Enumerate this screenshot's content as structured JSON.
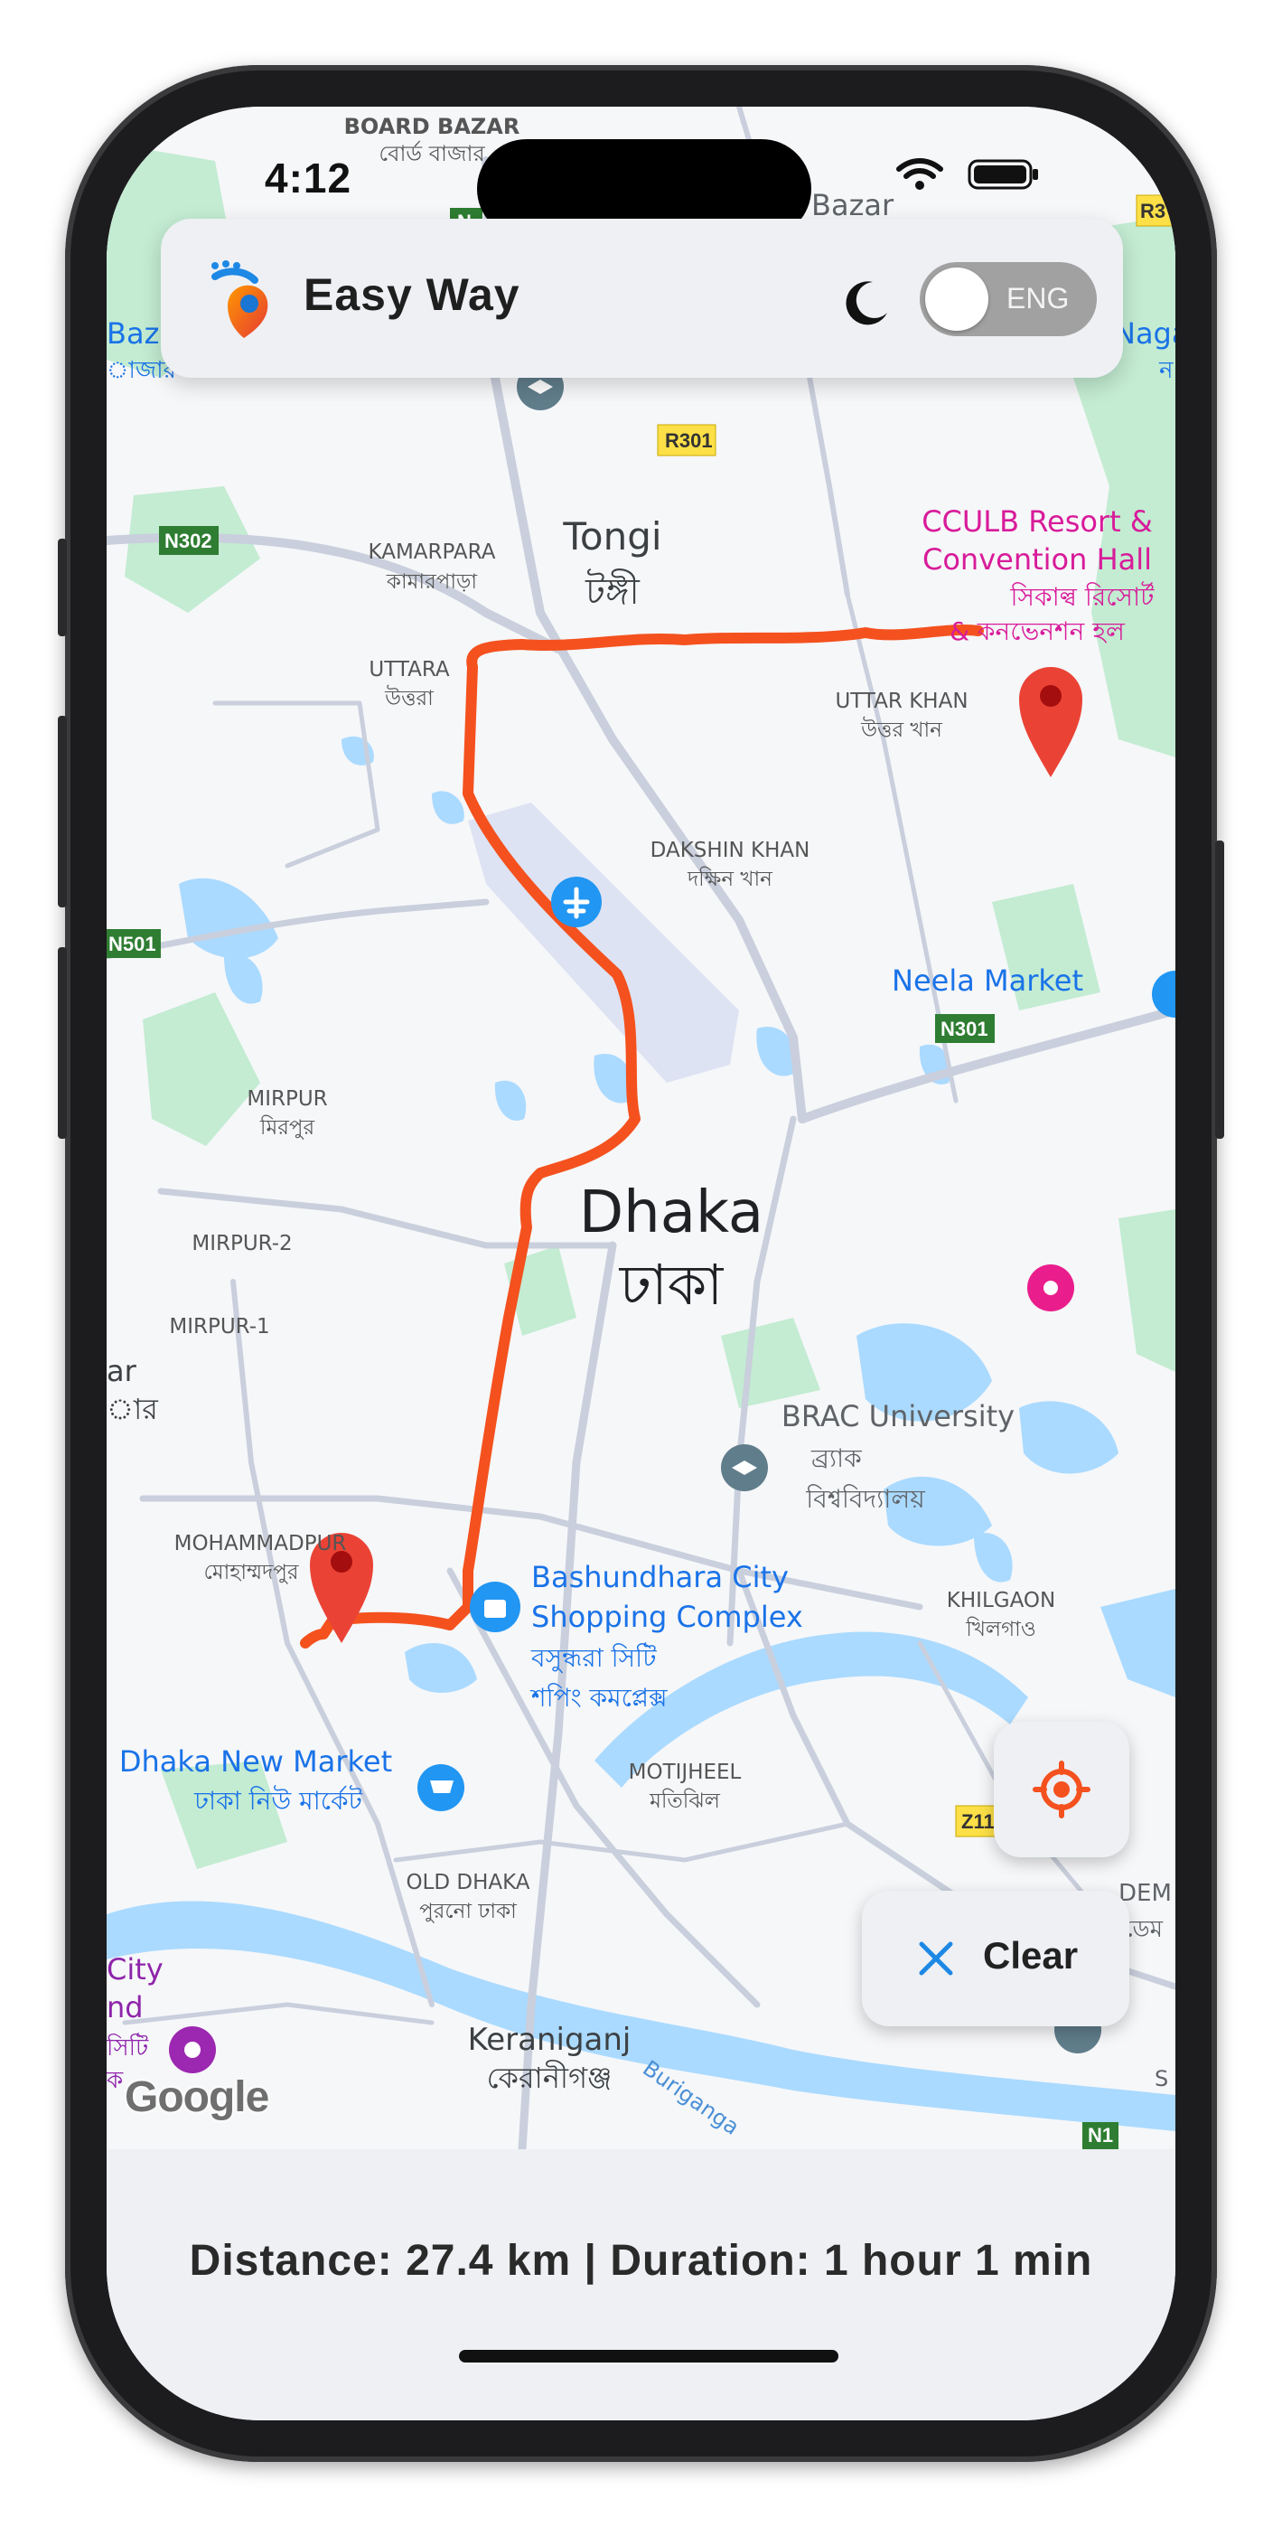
{
  "status_bar": {
    "time": "4:12"
  },
  "header": {
    "app_name": "Easy Way",
    "language_toggle_label": "ENG",
    "dark_mode_icon": "moon-icon"
  },
  "map": {
    "provider_logo": "Google",
    "place_labels": [
      {
        "id": "board-bazar",
        "en": "BOARD BAZAR",
        "bn": "বোর্ড বাজার"
      },
      {
        "id": "kamarpara",
        "en": "KAMARPARA",
        "bn": "কামারপাড়া"
      },
      {
        "id": "tongi",
        "en": "Tongi",
        "bn": "টঙ্গী"
      },
      {
        "id": "uttara",
        "en": "UTTARA",
        "bn": "উত্তরা"
      },
      {
        "id": "uttar-khan",
        "en": "UTTAR KHAN",
        "bn": "উত্তর খান"
      },
      {
        "id": "dakshin-khan",
        "en": "DAKSHIN KHAN",
        "bn": "দক্ষিন খান"
      },
      {
        "id": "mirpur",
        "en": "MIRPUR",
        "bn": "মিরপুর"
      },
      {
        "id": "mirpur-2",
        "en": "MIRPUR-2",
        "bn": ""
      },
      {
        "id": "mirpur-1",
        "en": "MIRPUR-1",
        "bn": ""
      },
      {
        "id": "dhaka",
        "en": "Dhaka",
        "bn": "ঢাকা"
      },
      {
        "id": "mohammadpur",
        "en": "MOHAMMADPUR",
        "bn": "মোহাম্মদপুর"
      },
      {
        "id": "motijheel",
        "en": "MOTIJHEEL",
        "bn": "মতিঝিল"
      },
      {
        "id": "old-dhaka",
        "en": "OLD DHAKA",
        "bn": "পুরনো ঢাকা"
      },
      {
        "id": "keraniganj",
        "en": "Keraniganj",
        "bn": "কেরানীগঞ্জ"
      },
      {
        "id": "khilgaon",
        "en": "KHILGAON",
        "bn": "খিলগাও"
      }
    ],
    "poi_labels": [
      {
        "id": "cculb",
        "lines": [
          "CCULB Resort &",
          "Convention Hall",
          "সিকাল্ব রিসোর্ট",
          "& কনভেনশন হল"
        ]
      },
      {
        "id": "neela-market",
        "lines": [
          "Neela Market"
        ]
      },
      {
        "id": "brac-university",
        "lines": [
          "BRAC University",
          "ব্র্যাক",
          "বিশ্ববিদ্যালয়"
        ]
      },
      {
        "id": "bashundhara",
        "lines": [
          "Bashundhara City",
          "Shopping Complex",
          "বসুন্ধরা সিটি",
          "শপিং কমপ্লেক্স"
        ]
      },
      {
        "id": "dhaka-new-market",
        "lines": [
          "Dhaka New Market",
          "ঢাকা নিউ মার্কেট"
        ]
      }
    ],
    "road_badges": [
      "R301",
      "N302",
      "N501",
      "N301",
      "Z11",
      "N1",
      "R3",
      "N"
    ],
    "edge_fragments": [
      "Bazar",
      "Baz",
      "াজার",
      "Naga",
      "ন",
      "ar",
      "ার",
      "City",
      "nd",
      "সিটি",
      "ক",
      "DEM",
      "ডেম",
      "S",
      "Buriganga"
    ],
    "colors": {
      "route": "#f4511e",
      "marker": "#ea4335",
      "water": "#aadaff",
      "park": "#c3ecd2",
      "land": "#f6f7f9",
      "road": "#c9cfdc"
    }
  },
  "controls": {
    "location_icon": "crosshair-icon",
    "clear_label": "Clear",
    "clear_icon": "close-icon"
  },
  "route_info": {
    "text": "Distance: 27.4 km | Duration: 1 hour 1 min"
  }
}
